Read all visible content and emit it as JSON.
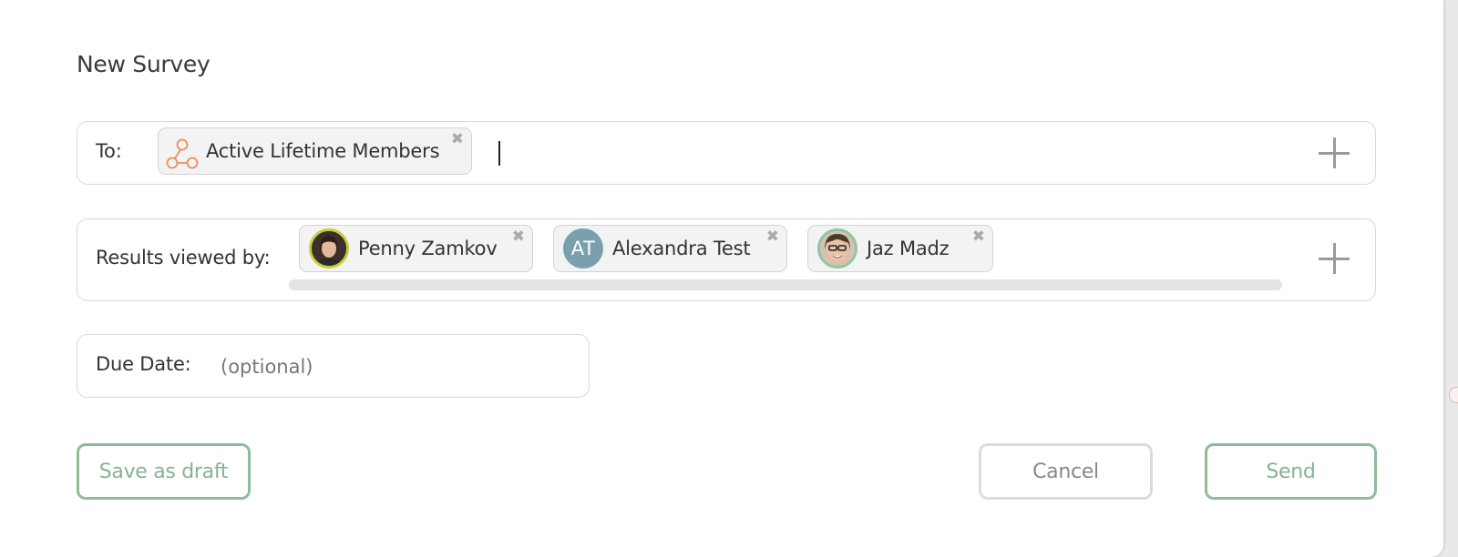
{
  "dialog": {
    "title": "New Survey"
  },
  "to_field": {
    "label": "To:",
    "recipients": [
      {
        "label": "Active Lifetime Members",
        "icon": "group-network-icon",
        "icon_color": "#e8915a"
      }
    ]
  },
  "viewers_field": {
    "label": "Results viewed by:",
    "people": [
      {
        "name": "Penny Zamkov",
        "avatar": "photo",
        "ring_color": "#c2cf3b"
      },
      {
        "name": "Alexandra Test",
        "avatar": "initials",
        "initials": "AT",
        "avatar_color": "#7a9fae"
      },
      {
        "name": "Jaz Madz",
        "avatar": "photo",
        "ring_color": "#8fc4a6"
      }
    ]
  },
  "due_date": {
    "label": "Due Date:",
    "placeholder": "(optional)"
  },
  "buttons": {
    "save_draft": "Save as draft",
    "cancel": "Cancel",
    "send": "Send"
  },
  "colors": {
    "accent_green": "#8fbb9c",
    "chip_background": "#f3f3f3",
    "field_border": "#d9d9d9"
  },
  "icons": {
    "remove": "close-icon",
    "add": "plus-icon"
  }
}
